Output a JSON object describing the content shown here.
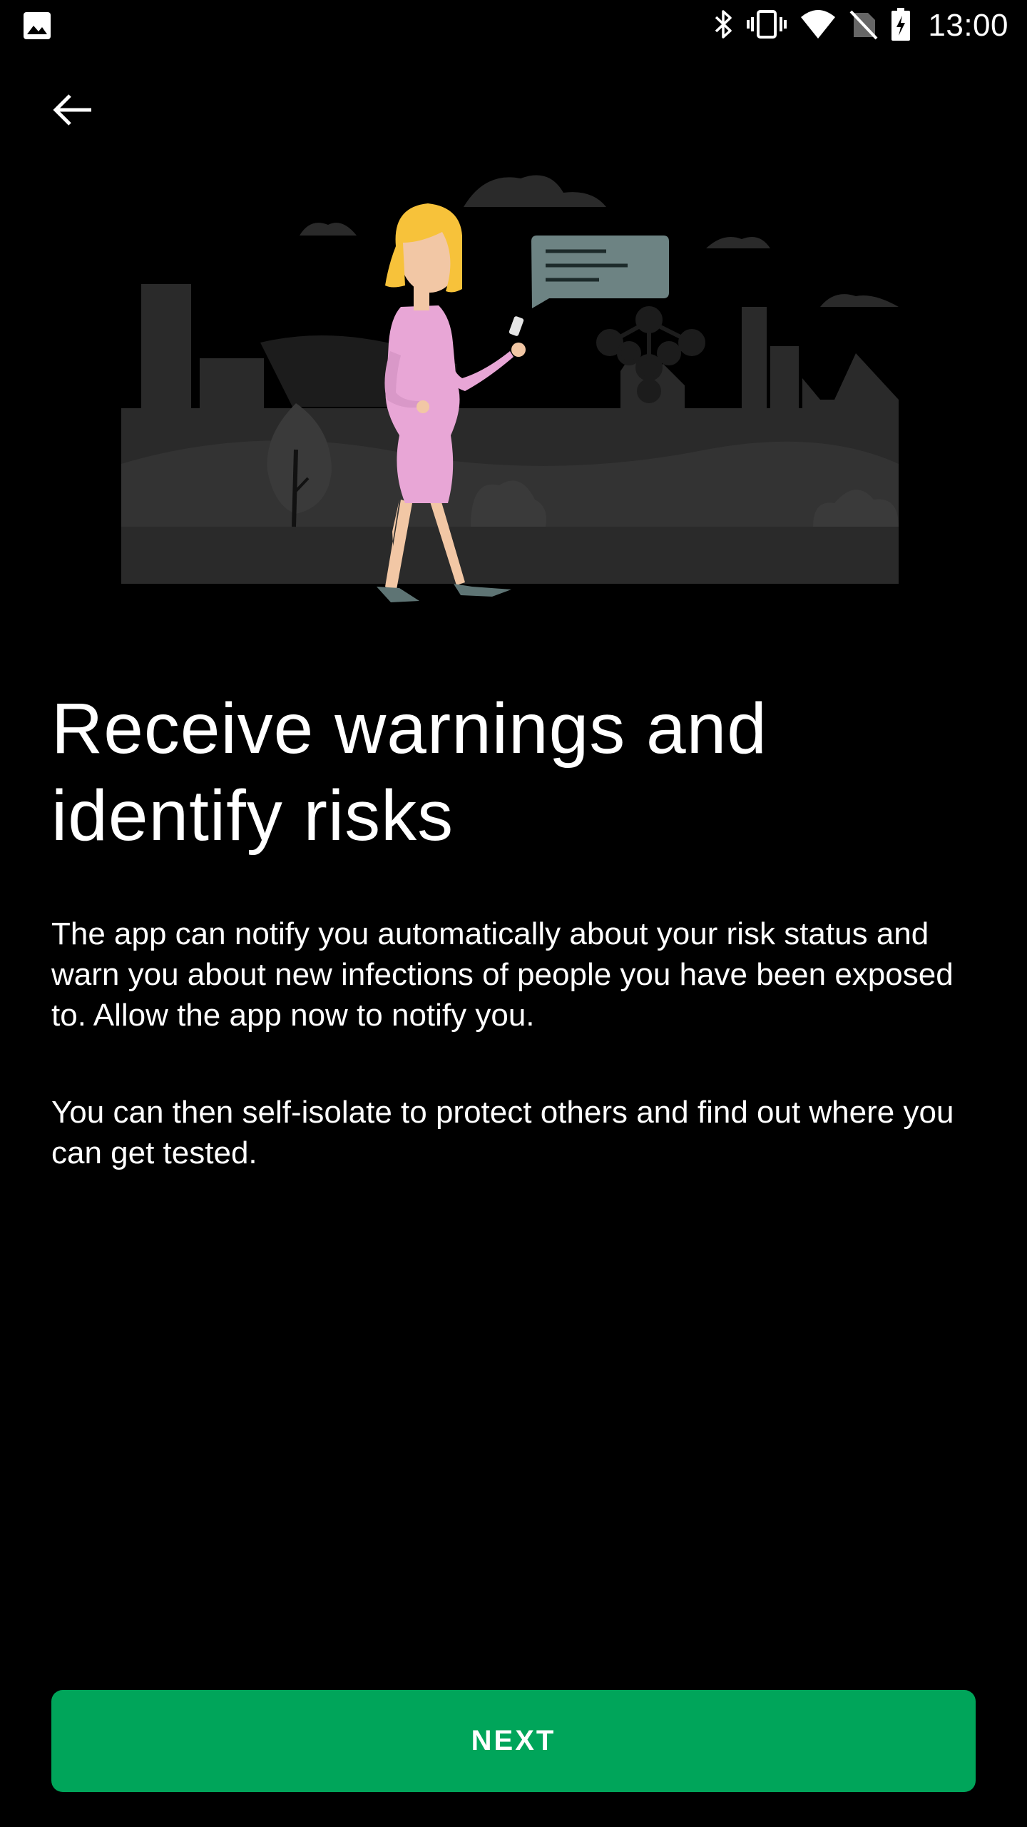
{
  "status_bar": {
    "time": "13:00",
    "icons": [
      "image-notification-icon",
      "bluetooth-icon",
      "vibrate-icon",
      "wifi-icon",
      "no-sim-icon",
      "battery-charging-icon"
    ]
  },
  "header": {
    "back_icon": "arrow-left-icon"
  },
  "illustration": {
    "subject": "woman-with-phone-city-illustration",
    "colors": {
      "skyline": "#2a2a2a",
      "skyline_dark": "#1f1f1f",
      "dress": "#e8a6d6",
      "hair": "#f7c23a",
      "skin": "#f2c7a5",
      "bubble": "#6d8383",
      "shoes": "#5e7474"
    }
  },
  "content": {
    "title": "Receive warnings and identify risks",
    "paragraph_1": "The app can notify you automatically about your risk status and warn you about new infections of people you have been exposed to. Allow the app now to notify you.",
    "paragraph_2": "You can then self-isolate to protect others and find out where you can get tested."
  },
  "footer": {
    "next_label": "NEXT",
    "accent": "#00a55a"
  }
}
